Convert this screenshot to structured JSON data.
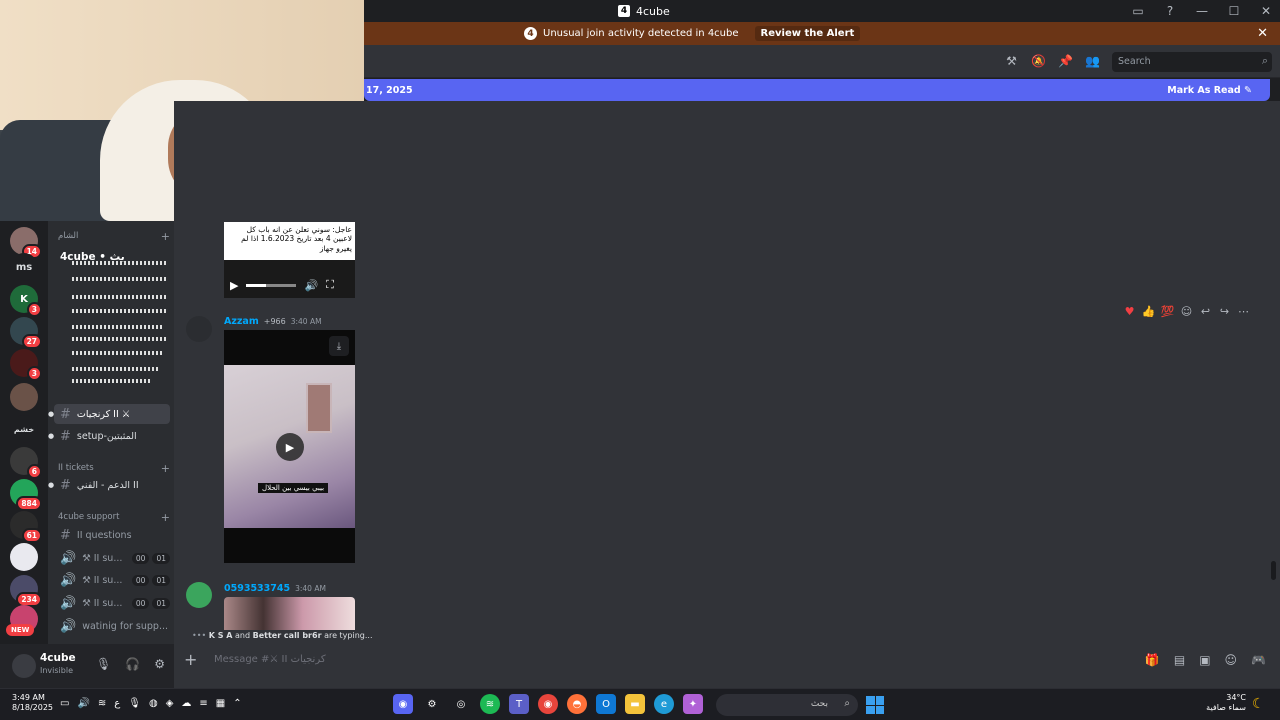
{
  "window": {
    "title": "4cube",
    "logo_letter": "4"
  },
  "window_controls": [
    "▭",
    "?",
    "—",
    "☐",
    "✕"
  ],
  "alert": {
    "count": "4",
    "text": "Unusual join activity detected in 4cube",
    "action": "Review the Alert",
    "close": "✕"
  },
  "header": {
    "search_placeholder": "Search",
    "icons": [
      "hammer-icon",
      "bell-slash-icon",
      "pin-icon",
      "members-icon"
    ]
  },
  "unread": {
    "date_fragment": "17, 2025",
    "mark_label": "Mark As Read"
  },
  "servers": [
    {
      "badge": "14"
    },
    {
      "label": "ms",
      "badge": ""
    },
    {
      "badge": "3"
    },
    {
      "badge": "27"
    },
    {
      "badge": "3"
    },
    {
      "badge": ""
    },
    {
      "label": "خشم",
      "badge": ""
    },
    {
      "badge": "6"
    },
    {
      "badge": "884"
    },
    {
      "badge": "61"
    },
    {
      "badge": ""
    },
    {
      "badge": "234"
    },
    {
      "badge": ""
    }
  ],
  "new_badge": "NEW",
  "channels": {
    "cat1": "الشام",
    "overlay_server": "4cube • بث",
    "active_channel": "كرنجيات II ⚔",
    "setup_channel": "setup-المثبتين",
    "tickets_cat": "II tickets",
    "support_channel": "الدعم - الفني II",
    "support_cat": "4cube support",
    "questions": "II questions",
    "voice": [
      {
        "label": "⚒ II su...",
        "a": "00",
        "b": "01"
      },
      {
        "label": "⚒ II su...",
        "a": "00",
        "b": "01"
      },
      {
        "label": "⚒ II su...",
        "a": "00",
        "b": "01"
      }
    ],
    "waiting": "watinig for supp..."
  },
  "user": {
    "name": "4cube",
    "status": "Invisible"
  },
  "post_image_text": "عاجل: سوني تعلن عن انه باب كل لاعبين 4 بعد تاريخ 1.6.2023 اذا لم يغيرو جهاز",
  "msg1": {
    "author": "Azzam",
    "tag": "+966",
    "time": "3:40 AM",
    "caption": "بيبي بيسي بين الحلال"
  },
  "msg2": {
    "author": "0593533745",
    "time": "3:40 AM"
  },
  "typing": {
    "users": "K S A",
    "joiner": "and",
    "user2": "Better call br6r",
    "suffix": "are typing..."
  },
  "composer": {
    "placeholder": "Message #⚔ II كرنجيات"
  },
  "taskbar": {
    "time": "3:49 AM",
    "date": "8/18/2025",
    "search": "بحث",
    "temp": "34°C",
    "weather": "سماء صافية"
  }
}
